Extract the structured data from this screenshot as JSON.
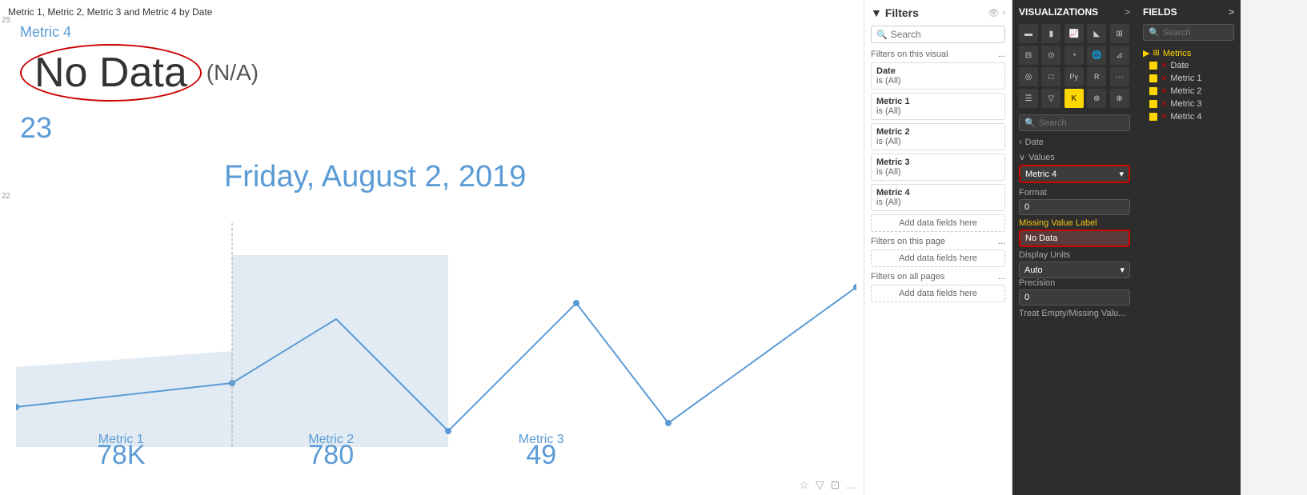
{
  "chart": {
    "title": "Metric 1, Metric 2, Metric 3 and Metric 4 by Date",
    "y_top": "25",
    "y_bottom": "22",
    "metric4_label": "Metric 4",
    "no_data_text": "No Data",
    "na_text": "(N/A)",
    "value_small": "23",
    "date_label": "Friday, August 2, 2019",
    "metric_labels": [
      "Metric 1",
      "Metric 2",
      "Metric 3"
    ],
    "metric_values": [
      "78K",
      "780",
      "49"
    ],
    "bottom_icons": [
      "☆",
      "▽",
      "⊡",
      "..."
    ]
  },
  "filters": {
    "title": "Filters",
    "search_placeholder": "Search",
    "this_visual_label": "Filters on this visual",
    "this_visual_more": "...",
    "filter_items": [
      {
        "name": "Date",
        "value": "is (All)"
      },
      {
        "name": "Metric 1",
        "value": "is (All)"
      },
      {
        "name": "Metric 2",
        "value": "is (All)"
      },
      {
        "name": "Metric 3",
        "value": "is (All)"
      },
      {
        "name": "Metric 4",
        "value": "is (All)"
      }
    ],
    "add_fields_label": "Add data fields here",
    "this_page_label": "Filters on this page",
    "this_page_more": "...",
    "add_fields_page_label": "Add data fields here",
    "all_pages_label": "Filters on all pages",
    "all_pages_more": "...",
    "add_fields_all_label": "Add data fields here"
  },
  "visualizations": {
    "title": "VISUALIZATIONS",
    "chevron": ">",
    "search_placeholder": "Search",
    "field_sections": [
      {
        "label": "Date",
        "type": "expand",
        "arrow": ">"
      },
      {
        "label": "Values",
        "type": "collapse",
        "arrow": "∨"
      }
    ],
    "values_dropdown": "Metric 4",
    "format_label": "Format",
    "format_value": "0",
    "missing_value_label": "Missing Value Label",
    "missing_value_value": "No Data",
    "display_units_label": "Display Units",
    "display_units_value": "Auto",
    "precision_label": "Precision",
    "precision_value": "0",
    "treat_empty_label": "Treat Empty/Missing Valu..."
  },
  "fields": {
    "title": "FIELDS",
    "chevron": ">",
    "search_placeholder": "Search",
    "groups": [
      {
        "name": "Metrics",
        "color": "gold",
        "items": [
          {
            "name": "Date",
            "checked": true
          },
          {
            "name": "Metric 1",
            "checked": true
          },
          {
            "name": "Metric 2",
            "checked": true
          },
          {
            "name": "Metric 3",
            "checked": true
          },
          {
            "name": "Metric 4",
            "checked": true
          }
        ]
      }
    ]
  }
}
